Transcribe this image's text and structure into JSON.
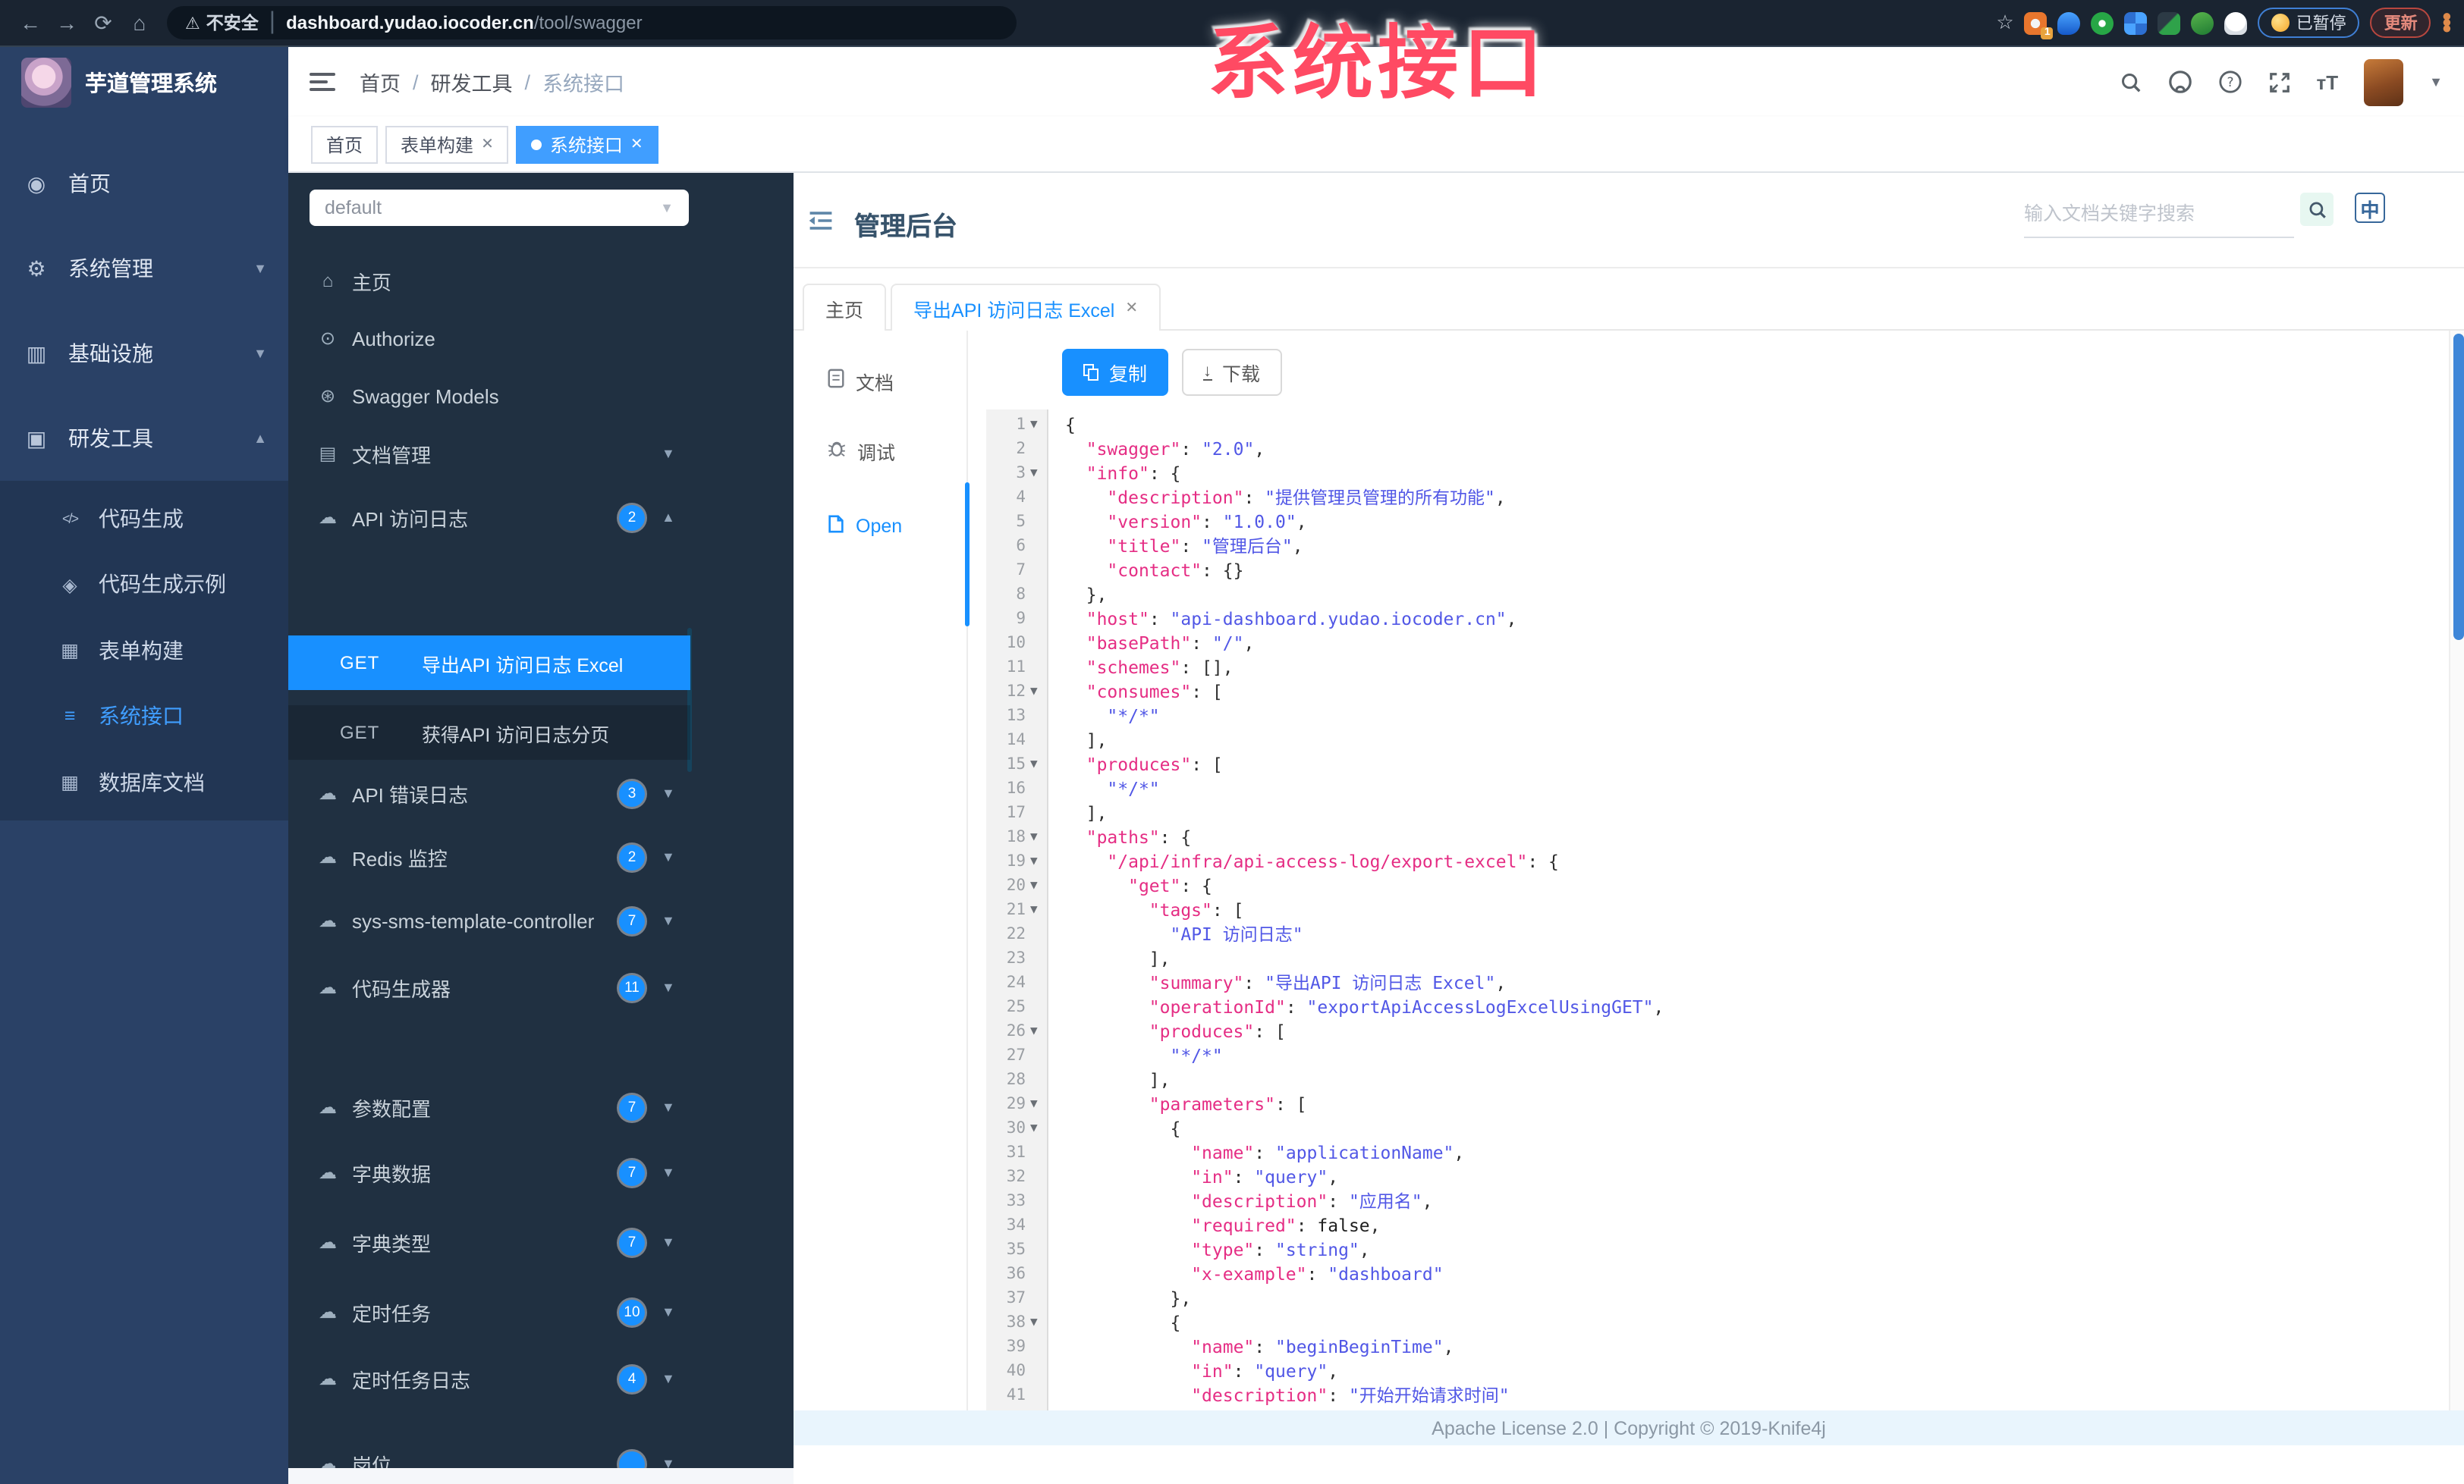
{
  "browser": {
    "security_label": "不安全",
    "url_host": "dashboard.yudao.iocoder.cn",
    "url_path": "/tool/swagger",
    "ext_badge": "1",
    "paused_label": "已暂停",
    "update_label": "更新"
  },
  "overlay": {
    "text": "系统接口",
    "color": "#ff4a63"
  },
  "sidebar": {
    "app_title": "芋道管理系统",
    "items": [
      {
        "label": "首页",
        "icon": "dashboard-icon",
        "chevron": ""
      },
      {
        "label": "系统管理",
        "icon": "gear-icon",
        "chevron": "down"
      },
      {
        "label": "基础设施",
        "icon": "infra-icon",
        "chevron": "down"
      },
      {
        "label": "研发工具",
        "icon": "tools-icon",
        "chevron": "up"
      }
    ],
    "sub_items": [
      {
        "label": "代码生成",
        "icon": "code-icon",
        "active": false
      },
      {
        "label": "代码生成示例",
        "icon": "shield-icon",
        "active": false
      },
      {
        "label": "表单构建",
        "icon": "form-icon",
        "active": false
      },
      {
        "label": "系统接口",
        "icon": "api-icon",
        "active": true
      },
      {
        "label": "数据库文档",
        "icon": "table-icon",
        "active": false
      }
    ]
  },
  "header": {
    "breadcrumb": [
      "首页",
      "研发工具",
      "系统接口"
    ],
    "tags": [
      {
        "label": "首页",
        "active": false,
        "closable": false
      },
      {
        "label": "表单构建",
        "active": false,
        "closable": true
      },
      {
        "label": "系统接口",
        "active": true,
        "closable": true
      }
    ]
  },
  "doc": {
    "group_select": "default",
    "menu": [
      {
        "label": "主页",
        "icon": "home-icon",
        "badge": "",
        "chevron": ""
      },
      {
        "label": "Authorize",
        "icon": "auth-icon",
        "badge": "",
        "chevron": ""
      },
      {
        "label": "Swagger Models",
        "icon": "models-icon",
        "badge": "",
        "chevron": ""
      },
      {
        "label": "文档管理",
        "icon": "docs-icon",
        "badge": "",
        "chevron": "down"
      },
      {
        "label": "API 访问日志",
        "icon": "cloud-icon",
        "badge": "2",
        "chevron": "up"
      }
    ],
    "operations": [
      {
        "method": "GET",
        "label": "导出API 访问日志 Excel",
        "active": true
      },
      {
        "method": "GET",
        "label": "获得API 访问日志分页",
        "active": false
      }
    ],
    "menu2": [
      {
        "label": "API 错误日志",
        "icon": "cloud-icon",
        "badge": "3"
      },
      {
        "label": "Redis 监控",
        "icon": "cloud-icon",
        "badge": "2"
      },
      {
        "label": "sys-sms-template-controller",
        "icon": "cloud-icon",
        "badge": "7"
      },
      {
        "label": "代码生成器",
        "icon": "cloud-icon",
        "badge": "11"
      },
      {
        "label": "参数配置",
        "icon": "cloud-icon",
        "badge": "7"
      },
      {
        "label": "字典数据",
        "icon": "cloud-icon",
        "badge": "7"
      },
      {
        "label": "字典类型",
        "icon": "cloud-icon",
        "badge": "7"
      },
      {
        "label": "定时任务",
        "icon": "cloud-icon",
        "badge": "10"
      },
      {
        "label": "定时任务日志",
        "icon": "cloud-icon",
        "badge": "4"
      },
      {
        "label": "岗位",
        "icon": "cloud-icon",
        "badge": ""
      }
    ],
    "title": "管理后台",
    "search_placeholder": "输入文档关键字搜索",
    "lang_toggle": "中",
    "tabs": [
      {
        "label": "主页",
        "active": false,
        "closable": false
      },
      {
        "label": "导出API 访问日志 Excel",
        "active": true,
        "closable": true
      }
    ],
    "side_tabs": [
      {
        "label": "文档",
        "icon": "document-icon",
        "active": false
      },
      {
        "label": "调试",
        "icon": "bug-icon",
        "active": false
      },
      {
        "label": "Open",
        "icon": "file-icon",
        "active": true
      }
    ],
    "copy_label": "复制",
    "download_label": "下载"
  },
  "editor": {
    "fold_lines": [
      1,
      3,
      12,
      15,
      18,
      19,
      20,
      21,
      26,
      29,
      30,
      38
    ],
    "lines": [
      [
        [
          "p",
          "{"
        ]
      ],
      [
        [
          "p",
          "  "
        ],
        [
          "k",
          "\"swagger\""
        ],
        [
          "p",
          ": "
        ],
        [
          "s",
          "\"2.0\""
        ],
        [
          "p",
          ","
        ]
      ],
      [
        [
          "p",
          "  "
        ],
        [
          "k",
          "\"info\""
        ],
        [
          "p",
          ": {"
        ]
      ],
      [
        [
          "p",
          "    "
        ],
        [
          "k",
          "\"description\""
        ],
        [
          "p",
          ": "
        ],
        [
          "s",
          "\"提供管理员管理的所有功能\""
        ],
        [
          "p",
          ","
        ]
      ],
      [
        [
          "p",
          "    "
        ],
        [
          "k",
          "\"version\""
        ],
        [
          "p",
          ": "
        ],
        [
          "s",
          "\"1.0.0\""
        ],
        [
          "p",
          ","
        ]
      ],
      [
        [
          "p",
          "    "
        ],
        [
          "k",
          "\"title\""
        ],
        [
          "p",
          ": "
        ],
        [
          "s",
          "\"管理后台\""
        ],
        [
          "p",
          ","
        ]
      ],
      [
        [
          "p",
          "    "
        ],
        [
          "k",
          "\"contact\""
        ],
        [
          "p",
          ": {}"
        ]
      ],
      [
        [
          "p",
          "  },"
        ]
      ],
      [
        [
          "p",
          "  "
        ],
        [
          "k",
          "\"host\""
        ],
        [
          "p",
          ": "
        ],
        [
          "s",
          "\"api-dashboard.yudao.iocoder.cn\""
        ],
        [
          "p",
          ","
        ]
      ],
      [
        [
          "p",
          "  "
        ],
        [
          "k",
          "\"basePath\""
        ],
        [
          "p",
          ": "
        ],
        [
          "s",
          "\"/\""
        ],
        [
          "p",
          ","
        ]
      ],
      [
        [
          "p",
          "  "
        ],
        [
          "k",
          "\"schemes\""
        ],
        [
          "p",
          ": [],"
        ]
      ],
      [
        [
          "p",
          "  "
        ],
        [
          "k",
          "\"consumes\""
        ],
        [
          "p",
          ": ["
        ]
      ],
      [
        [
          "p",
          "    "
        ],
        [
          "s",
          "\"*/*\""
        ]
      ],
      [
        [
          "p",
          "  ],"
        ]
      ],
      [
        [
          "p",
          "  "
        ],
        [
          "k",
          "\"produces\""
        ],
        [
          "p",
          ": ["
        ]
      ],
      [
        [
          "p",
          "    "
        ],
        [
          "s",
          "\"*/*\""
        ]
      ],
      [
        [
          "p",
          "  ],"
        ]
      ],
      [
        [
          "p",
          "  "
        ],
        [
          "k",
          "\"paths\""
        ],
        [
          "p",
          ": {"
        ]
      ],
      [
        [
          "p",
          "    "
        ],
        [
          "k",
          "\"/api/infra/api-access-log/export-excel\""
        ],
        [
          "p",
          ": {"
        ]
      ],
      [
        [
          "p",
          "      "
        ],
        [
          "k",
          "\"get\""
        ],
        [
          "p",
          ": {"
        ]
      ],
      [
        [
          "p",
          "        "
        ],
        [
          "k",
          "\"tags\""
        ],
        [
          "p",
          ": ["
        ]
      ],
      [
        [
          "p",
          "          "
        ],
        [
          "s",
          "\"API 访问日志\""
        ]
      ],
      [
        [
          "p",
          "        ],"
        ]
      ],
      [
        [
          "p",
          "        "
        ],
        [
          "k",
          "\"summary\""
        ],
        [
          "p",
          ": "
        ],
        [
          "s",
          "\"导出API 访问日志 Excel\""
        ],
        [
          "p",
          ","
        ]
      ],
      [
        [
          "p",
          "        "
        ],
        [
          "k",
          "\"operationId\""
        ],
        [
          "p",
          ": "
        ],
        [
          "s",
          "\"exportApiAccessLogExcelUsingGET\""
        ],
        [
          "p",
          ","
        ]
      ],
      [
        [
          "p",
          "        "
        ],
        [
          "k",
          "\"produces\""
        ],
        [
          "p",
          ": ["
        ]
      ],
      [
        [
          "p",
          "          "
        ],
        [
          "s",
          "\"*/*\""
        ]
      ],
      [
        [
          "p",
          "        ],"
        ]
      ],
      [
        [
          "p",
          "        "
        ],
        [
          "k",
          "\"parameters\""
        ],
        [
          "p",
          ": ["
        ]
      ],
      [
        [
          "p",
          "          {"
        ]
      ],
      [
        [
          "p",
          "            "
        ],
        [
          "k",
          "\"name\""
        ],
        [
          "p",
          ": "
        ],
        [
          "s",
          "\"applicationName\""
        ],
        [
          "p",
          ","
        ]
      ],
      [
        [
          "p",
          "            "
        ],
        [
          "k",
          "\"in\""
        ],
        [
          "p",
          ": "
        ],
        [
          "s",
          "\"query\""
        ],
        [
          "p",
          ","
        ]
      ],
      [
        [
          "p",
          "            "
        ],
        [
          "k",
          "\"description\""
        ],
        [
          "p",
          ": "
        ],
        [
          "s",
          "\"应用名\""
        ],
        [
          "p",
          ","
        ]
      ],
      [
        [
          "p",
          "            "
        ],
        [
          "k",
          "\"required\""
        ],
        [
          "p",
          ": "
        ],
        [
          "b",
          "false"
        ],
        [
          "p",
          ","
        ]
      ],
      [
        [
          "p",
          "            "
        ],
        [
          "k",
          "\"type\""
        ],
        [
          "p",
          ": "
        ],
        [
          "s",
          "\"string\""
        ],
        [
          "p",
          ","
        ]
      ],
      [
        [
          "p",
          "            "
        ],
        [
          "k",
          "\"x-example\""
        ],
        [
          "p",
          ": "
        ],
        [
          "s",
          "\"dashboard\""
        ]
      ],
      [
        [
          "p",
          "          },"
        ]
      ],
      [
        [
          "p",
          "          {"
        ]
      ],
      [
        [
          "p",
          "            "
        ],
        [
          "k",
          "\"name\""
        ],
        [
          "p",
          ": "
        ],
        [
          "s",
          "\"beginBeginTime\""
        ],
        [
          "p",
          ","
        ]
      ],
      [
        [
          "p",
          "            "
        ],
        [
          "k",
          "\"in\""
        ],
        [
          "p",
          ": "
        ],
        [
          "s",
          "\"query\""
        ],
        [
          "p",
          ","
        ]
      ],
      [
        [
          "p",
          "            "
        ],
        [
          "k",
          "\"description\""
        ],
        [
          "p",
          ": "
        ],
        [
          "s",
          "\"开始开始请求时间\""
        ]
      ]
    ]
  },
  "footer": {
    "text": "Apache License 2.0 | Copyright © 2019-Knife4j"
  }
}
